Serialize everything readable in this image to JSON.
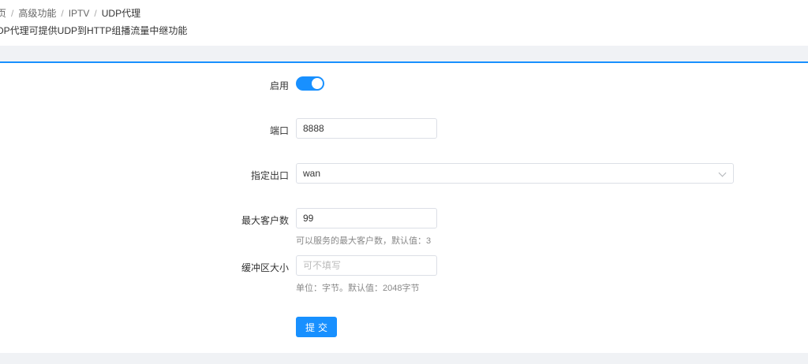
{
  "breadcrumb": {
    "items": [
      "页",
      "高级功能",
      "IPTV",
      "UDP代理"
    ],
    "separator": "/"
  },
  "page": {
    "description": "DP代理可提供UDP到HTTP组播流量中继功能"
  },
  "form": {
    "enable": {
      "label": "启用",
      "on": true
    },
    "port": {
      "label": "端口",
      "value": "8888"
    },
    "interface": {
      "label": "指定出口",
      "value": "wan"
    },
    "max_clients": {
      "label": "最大客户数",
      "value": "99",
      "help": "可以服务的最大客户数，默认值：3"
    },
    "buffer_size": {
      "label": "缓冲区大小",
      "value": "",
      "placeholder": "可不填写",
      "help": "单位：字节。默认值：2048字节"
    },
    "submit_label": "提交"
  },
  "colors": {
    "primary": "#1890ff",
    "band": "#f0f2f5"
  }
}
